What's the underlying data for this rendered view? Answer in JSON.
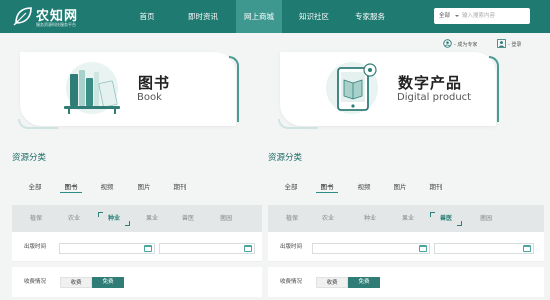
{
  "header": {
    "logo_title": "农知网",
    "logo_subtitle": "服务资源科技服务平台",
    "nav": [
      {
        "label": "首页",
        "active": false
      },
      {
        "label": "即时资讯",
        "active": false
      },
      {
        "label": "网上商城",
        "active": true
      },
      {
        "label": "知识社区",
        "active": false
      },
      {
        "label": "专家服务",
        "active": false
      }
    ],
    "search": {
      "scope": "全部",
      "placeholder": "输入搜索内容"
    }
  },
  "userbar": {
    "expert_link": "- 成为专家",
    "login_link": "- 登录"
  },
  "cards": [
    {
      "title": "图书",
      "subtitle": "Book"
    },
    {
      "title": "数字产品",
      "subtitle": "Digital product"
    }
  ],
  "panels": [
    {
      "section_title": "资源分类",
      "tabs": [
        "全部",
        "图书",
        "视频",
        "图片",
        "期刊"
      ],
      "active_tab": 1,
      "categories": [
        "植保",
        "农业",
        "种业",
        "果业",
        "兽医",
        "菌园"
      ],
      "active_category": 2,
      "date_label": "出版时间",
      "fee_label": "收费情况",
      "fee_options": [
        "收费",
        "免费"
      ],
      "active_fee": 1
    },
    {
      "section_title": "资源分类",
      "tabs": [
        "全部",
        "图书",
        "视频",
        "图片",
        "期刊"
      ],
      "active_tab": 1,
      "categories": [
        "植保",
        "农业",
        "种业",
        "果业",
        "兽医",
        "菌园"
      ],
      "active_category": 4,
      "date_label": "出版时间",
      "fee_label": "收费情况",
      "fee_options": [
        "收费",
        "免费"
      ],
      "active_fee": 1
    }
  ],
  "colors": {
    "brand": "#1f7a72",
    "accent": "#2f7d76",
    "nav_active": "#3f9890"
  }
}
